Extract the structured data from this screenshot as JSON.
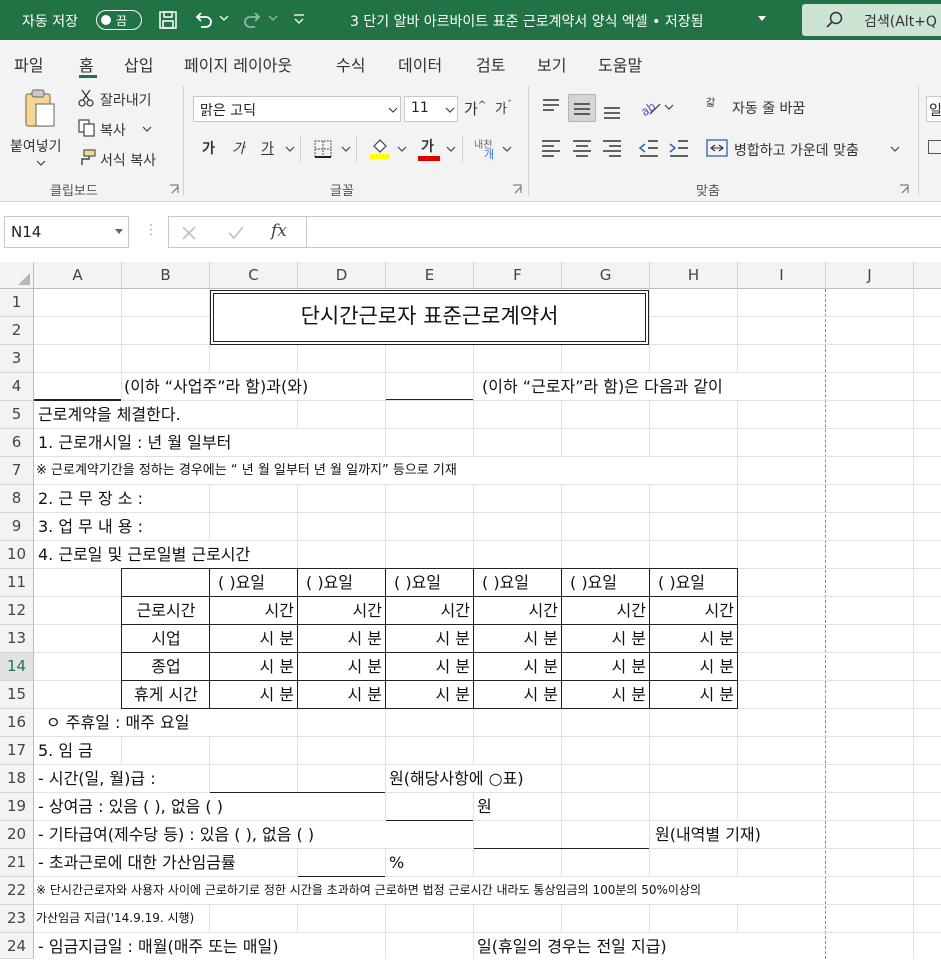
{
  "titlebar": {
    "autosave_label": "자동 저장",
    "autosave_state": "끔",
    "doc_title": "3 단기 알바 아르바이트 표준 근로계약서 양식 엑셀 • 저장됨",
    "search_placeholder": "검색(Alt+Q"
  },
  "menu": [
    "파일",
    "홈",
    "삽입",
    "페이지 레이아웃",
    "수식",
    "데이터",
    "검토",
    "보기",
    "도움말"
  ],
  "ribbon": {
    "paste": "붙여넣기",
    "cut": "잘라내기",
    "copy": "복사",
    "format_painter": "서식 복사",
    "clipboard_group": "클립보드",
    "font_name": "맑은 고딕",
    "font_size": "11",
    "bold": "가",
    "italic": "가",
    "underline": "가",
    "font_color_glyph": "가",
    "phonetic": "내천",
    "font_group": "글꼴",
    "wrap_text": "자동 줄 바꿈",
    "merge_center": "병합하고 가운데 맞춤",
    "align_group": "맞춤",
    "number_partial": "일"
  },
  "formula_bar": {
    "name_box": "N14",
    "fx": "fx"
  },
  "columns": [
    "A",
    "B",
    "C",
    "D",
    "E",
    "F",
    "G",
    "H",
    "I",
    "J"
  ],
  "rows": [
    "1",
    "2",
    "3",
    "4",
    "5",
    "6",
    "7",
    "8",
    "9",
    "10",
    "11",
    "12",
    "13",
    "14",
    "15",
    "16",
    "17",
    "18",
    "19",
    "20",
    "21",
    "22",
    "23",
    "24"
  ],
  "sheet": {
    "title": "단시간근로자 표준근로계약서",
    "r4_b": "(이하 “사업주”라 함)과(와)",
    "r4_f": "(이하 “근로자”라 함)은 다음과 같이",
    "r5": "근로계약을 체결한다.",
    "r6": "1. 근로개시일 :        년    월    일부터",
    "r7": "※ 근로계약기간을 정하는 경우에는 “     년     월     일부터     년     월     일까지” 등으로 기재",
    "r8": "2. 근 무 장 소 :",
    "r9": "3. 업 무 내 용 :",
    "r10": "4. 근로일 및 근로일별 근로시간",
    "day_header": "(     )요일",
    "row_labels": [
      "근로시간",
      "시업",
      "종업",
      "휴게 시간"
    ],
    "hours": "시간",
    "minutes": "시 분",
    "r16": "ㅇ 주휴일 : 매주    요일",
    "r17": "5. 임  금",
    "r18_a": "  - 시간(일, 월)급 :",
    "r18_e": "원(해당사항에 ○표)",
    "r19_a": "  - 상여금 : 있음 (     ),   없음 (     )",
    "r19_f": "원",
    "r20_a": "  - 기타급여(제수당 등) : 있음 (     ),    없음 (     )",
    "r20_h": "원(내역별 기재)",
    "r21_a": " - 초과근로에 대한 가산임금률",
    "r21_e": "%",
    "r22": "※ 단시간근로자와 사용자 사이에 근로하기로 정한 시간을 초과하여 근로하면 법정 근로시간 내라도 통상임금의 100분의 50%이상의",
    "r23": "가산임금 지급('14.9.19. 시행)",
    "r24_a": "  - 임금지급일 : 매월(매주 또는 매일)",
    "r24_f": "일(휴일의 경우는 전일 지급)"
  }
}
